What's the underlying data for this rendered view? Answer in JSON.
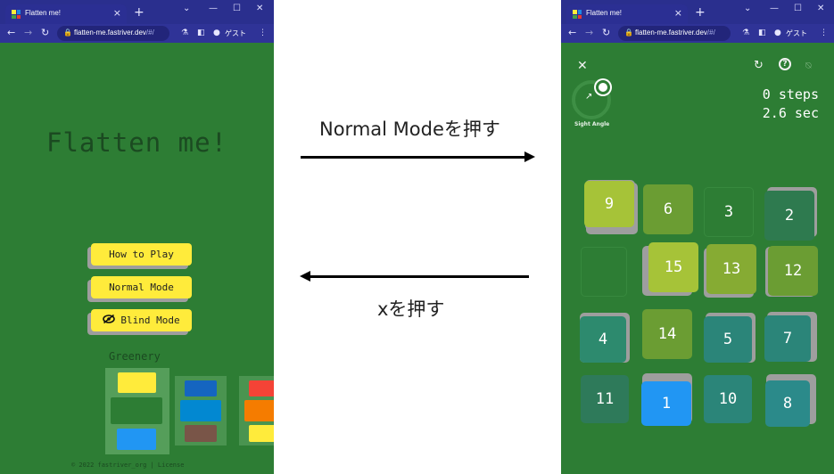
{
  "browser": {
    "tab_title": "Flatten me!",
    "url_host": "flatten-me.fastriver.dev",
    "url_path": "/#/",
    "guest_label": "ゲスト"
  },
  "menu_page": {
    "title": "Flatten me!",
    "buttons": [
      "How to Play",
      "Normal Mode",
      "Blind Mode"
    ],
    "theme_label": "Greenery",
    "footer": "© 2022 fastriver_org | License"
  },
  "annotations": {
    "forward_label": "Normal Modeを押す",
    "back_label": "xを押す"
  },
  "game_page": {
    "steps_text": "0 steps",
    "time_text": "2.6 sec",
    "dial_label": "Sight Angle",
    "tiles": [
      [
        "9",
        "6",
        "3",
        "2"
      ],
      [
        "",
        "15",
        "13",
        "12"
      ],
      [
        "4",
        "14",
        "5",
        "7"
      ],
      [
        "11",
        "1",
        "10",
        "8"
      ]
    ]
  },
  "colors": {
    "page_green": "#2d7d34",
    "button_yellow": "#ffeb3b",
    "chrome_blue": "#2a2f8e"
  },
  "icons": [
    "close-icon",
    "refresh-icon",
    "help-icon",
    "vibration-off-icon",
    "eye-off-icon",
    "lock-icon"
  ]
}
